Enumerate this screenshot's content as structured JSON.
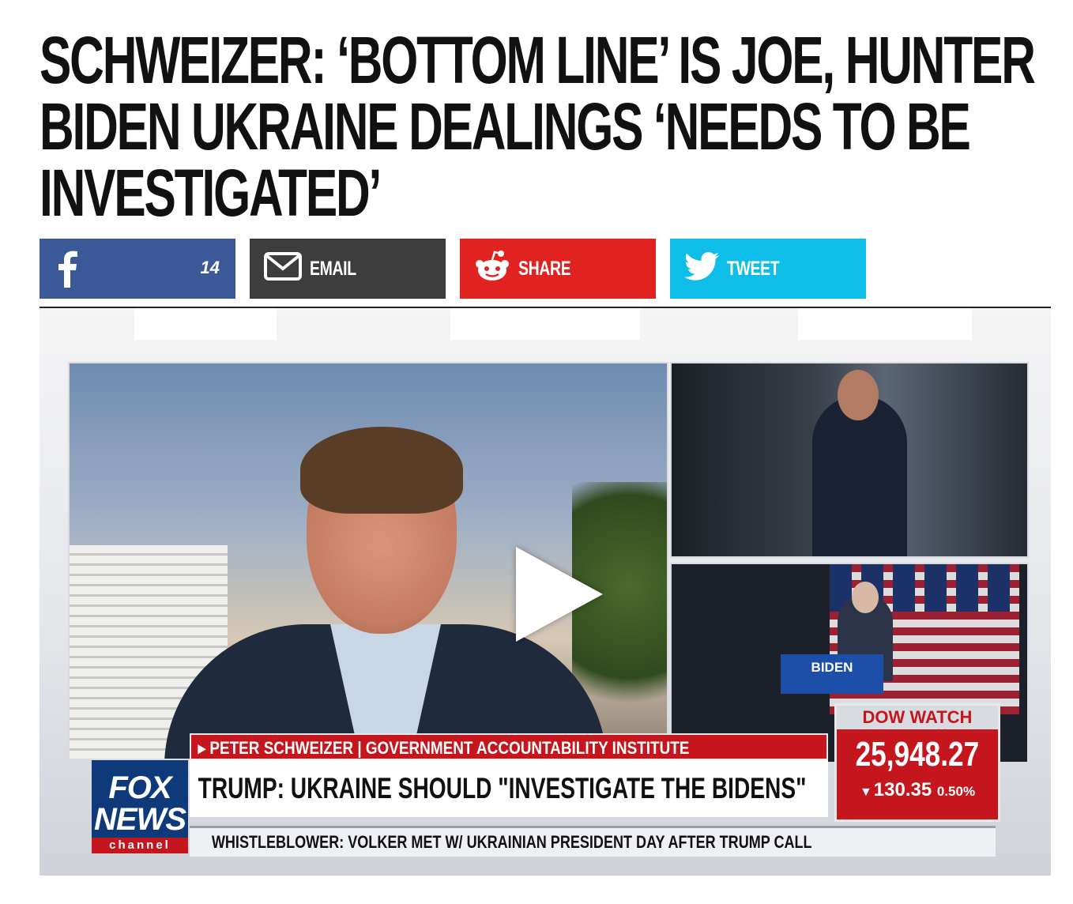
{
  "article": {
    "headline": "SCHWEIZER: ‘BOTTOM LINE’ IS JOE, HUNTER BIDEN UKRAINE DEALINGS ‘NEEDS TO BE INVESTIGATED’"
  },
  "share": {
    "facebook_count": "14",
    "email_label": "EMAIL",
    "share_label": "SHARE",
    "tweet_label": "TWEET",
    "colors": {
      "facebook": "#3b5998",
      "email": "#3d3d3d",
      "reddit": "#e02321",
      "twitter": "#0fbde9"
    }
  },
  "video": {
    "chyron_name": "PETER SCHWEIZER",
    "chyron_title": "GOVERNMENT ACCOUNTABILITY INSTITUTE",
    "chyron_headline": "TRUMP: UKRAINE SHOULD \"INVESTIGATE THE BIDENS\"",
    "ticker": "WHISTLEBLOWER: VOLKER MET W/ UKRAINIAN PRESIDENT DAY AFTER TRUMP CALL",
    "logo_line1": "FOX",
    "logo_line2": "NEWS",
    "logo_line3": "channel",
    "podium_text": "BIDEN",
    "dow": {
      "title": "DOW WATCH",
      "value": "25,948.27",
      "change": "130.35",
      "percent": "0.50%"
    }
  }
}
